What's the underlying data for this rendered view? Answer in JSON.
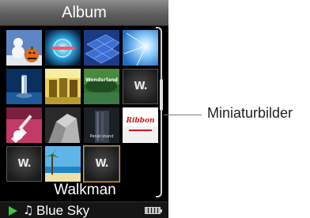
{
  "title": "Album",
  "selected_album_label": "Walkman",
  "now_playing": {
    "play_icon": "play-icon",
    "note_icon": "music-note-icon",
    "note_glyph": "♫",
    "song": "Blue Sky",
    "battery_icon": "battery-icon"
  },
  "callout": "Miniaturbilder",
  "thumbnails": [
    {
      "art": "snowman-pumpkin"
    },
    {
      "art": "blue-sphere"
    },
    {
      "art": "blue-tiles"
    },
    {
      "art": "light-rays"
    },
    {
      "art": "blue-tower"
    },
    {
      "art": "yellow-doors"
    },
    {
      "art": "tree-panorama",
      "caption": "Wonderland"
    },
    {
      "art": "walkman-logo"
    },
    {
      "art": "guitar"
    },
    {
      "art": "gray-building"
    },
    {
      "art": "dark-tower",
      "caption": "Pensil stand"
    },
    {
      "art": "red-logo",
      "caption": "Ribbon"
    },
    {
      "art": "walkman-logo"
    },
    {
      "art": "beach"
    },
    {
      "art": "walkman-logo",
      "selected": true
    }
  ],
  "colors": {
    "selection": "#e39a1d",
    "play": "#3ec640"
  }
}
